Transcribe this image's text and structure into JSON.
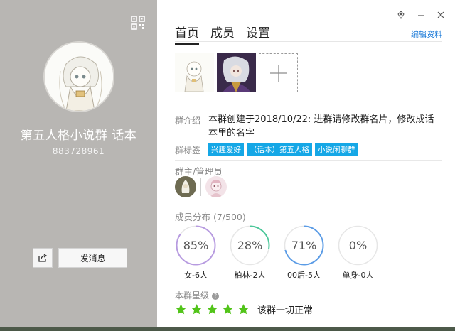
{
  "left_panel": {
    "group_name": "第五人格小说群  话本",
    "group_id": "883728961",
    "send_message_label": "发消息"
  },
  "tabs": [
    {
      "label": "首页",
      "active": true
    },
    {
      "label": "成员",
      "active": false
    },
    {
      "label": "设置",
      "active": false
    }
  ],
  "edit_profile_label": "编辑资料",
  "intro": {
    "label": "群介绍",
    "text": "本群创建于2018/10/22:  进群请修改群名片，修改成话本里的名字"
  },
  "tags": {
    "label": "群标签",
    "items": [
      "兴趣爱好",
      "（话本）第五人格",
      "小说闲聊群"
    ]
  },
  "admins": {
    "label": "群主/管理员"
  },
  "distribution": {
    "label": "成员分布 (7/500)",
    "items": [
      {
        "pct": "85%",
        "value": 0.85,
        "label": "女-6人",
        "color": "#b79be0"
      },
      {
        "pct": "28%",
        "value": 0.28,
        "label": "柏林-2人",
        "color": "#4cc79a"
      },
      {
        "pct": "71%",
        "value": 0.71,
        "label": "00后-5人",
        "color": "#5b9ce6"
      },
      {
        "pct": "0%",
        "value": 0.0,
        "label": "单身-0人",
        "color": "#cfcfcf"
      }
    ]
  },
  "level": {
    "label": "本群星级",
    "stars": 5,
    "star_color": "#52c41a",
    "status_text": "该群一切正常"
  },
  "accent_color": "#15a7e6"
}
